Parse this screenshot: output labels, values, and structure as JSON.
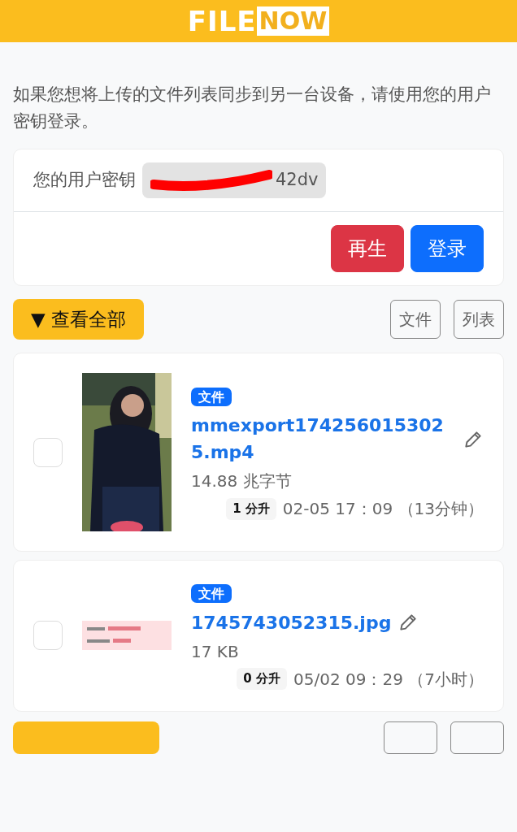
{
  "header": {
    "logo_left": "FILE",
    "logo_right": "NOW"
  },
  "intro": "如果您想将上传的文件列表同步到另一台设备，请使用您的用户密钥登录。",
  "key_card": {
    "label": "您的用户密钥",
    "key_visible": "42dv",
    "redacted": true,
    "buttons": [
      {
        "kind": "danger",
        "label": "再生"
      },
      {
        "kind": "primary",
        "label": "登录"
      }
    ]
  },
  "toolbar": {
    "toggle": "▼ 查看全部",
    "views": [
      "文件",
      "列表"
    ]
  },
  "files": [
    {
      "checked": false,
      "badge": "文件",
      "name": "mmexport1742560153025.mp4",
      "size": "14.88 兆字节",
      "downloads": "1 分升",
      "date": "02-05 17：09 （13分钟）"
    },
    {
      "checked": false,
      "badge": "文件",
      "name": "1745743052315.jpg",
      "size": "17 KB",
      "downloads": "0 分升",
      "date": "05/02 09：29 （7小时）"
    }
  ],
  "bottom_toolbar": {
    "buttons": [
      {
        "kind": "toggle"
      },
      {
        "kind": "view"
      },
      {
        "kind": "view"
      }
    ]
  }
}
